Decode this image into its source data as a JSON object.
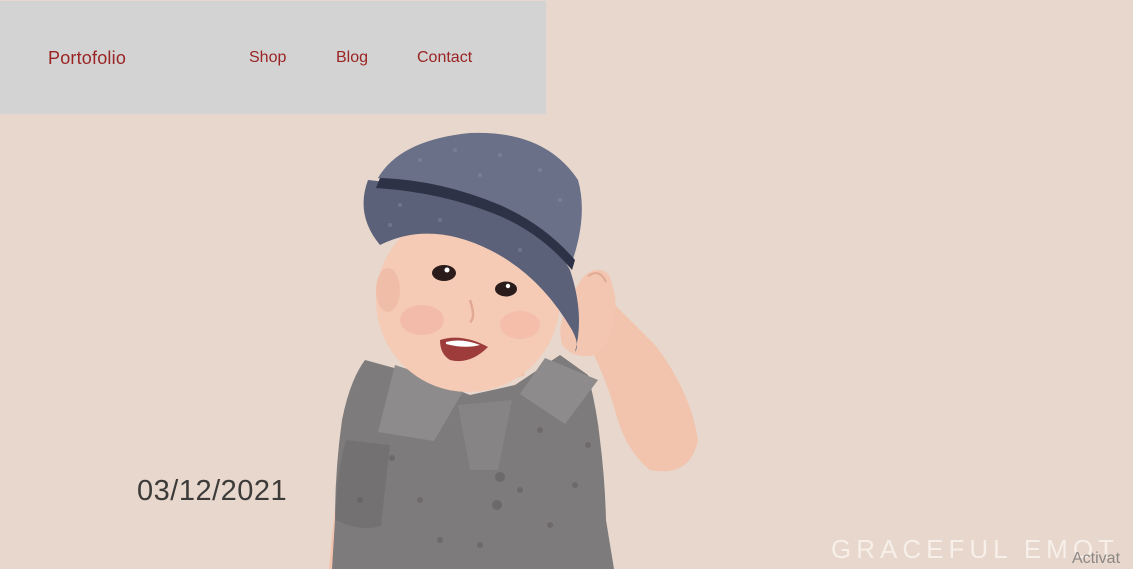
{
  "nav": {
    "brand": "Portofolio",
    "links": [
      {
        "label": "Shop"
      },
      {
        "label": "Blog"
      },
      {
        "label": "Contact"
      }
    ]
  },
  "hero": {
    "date": "03/12/2021",
    "tagline": "GRACEFUL EMOT",
    "image_subject": "toddler-in-hat-photo"
  },
  "overlay": {
    "watermark": "Activat"
  },
  "colors": {
    "background": "#e7d7cc",
    "nav_background": "#d3d3d3",
    "accent": "#9a2323",
    "date_text": "#3d3b3a",
    "tagline_text": "#f7efe9"
  }
}
